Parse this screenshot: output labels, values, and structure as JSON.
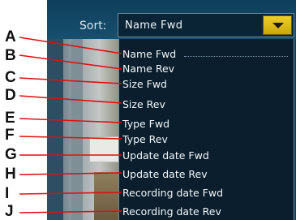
{
  "sort": {
    "label": "Sort:",
    "selected": "Name Fwd",
    "button_icon": "chevron-down-icon",
    "options": [
      "Name Fwd",
      "Name Rev",
      "Size Fwd",
      "Size Rev",
      "Type Fwd",
      "Type Rev",
      "Update date Fwd",
      "Update date Rev",
      "Recording date Fwd",
      "Recording date Rev"
    ]
  },
  "callouts": [
    "A",
    "B",
    "C",
    "D",
    "E",
    "F",
    "G",
    "H",
    "I",
    "J"
  ],
  "colors": {
    "callout_line": "#e01010",
    "list_background": "#0a1e2d",
    "button_accent": "#e8c51a"
  }
}
